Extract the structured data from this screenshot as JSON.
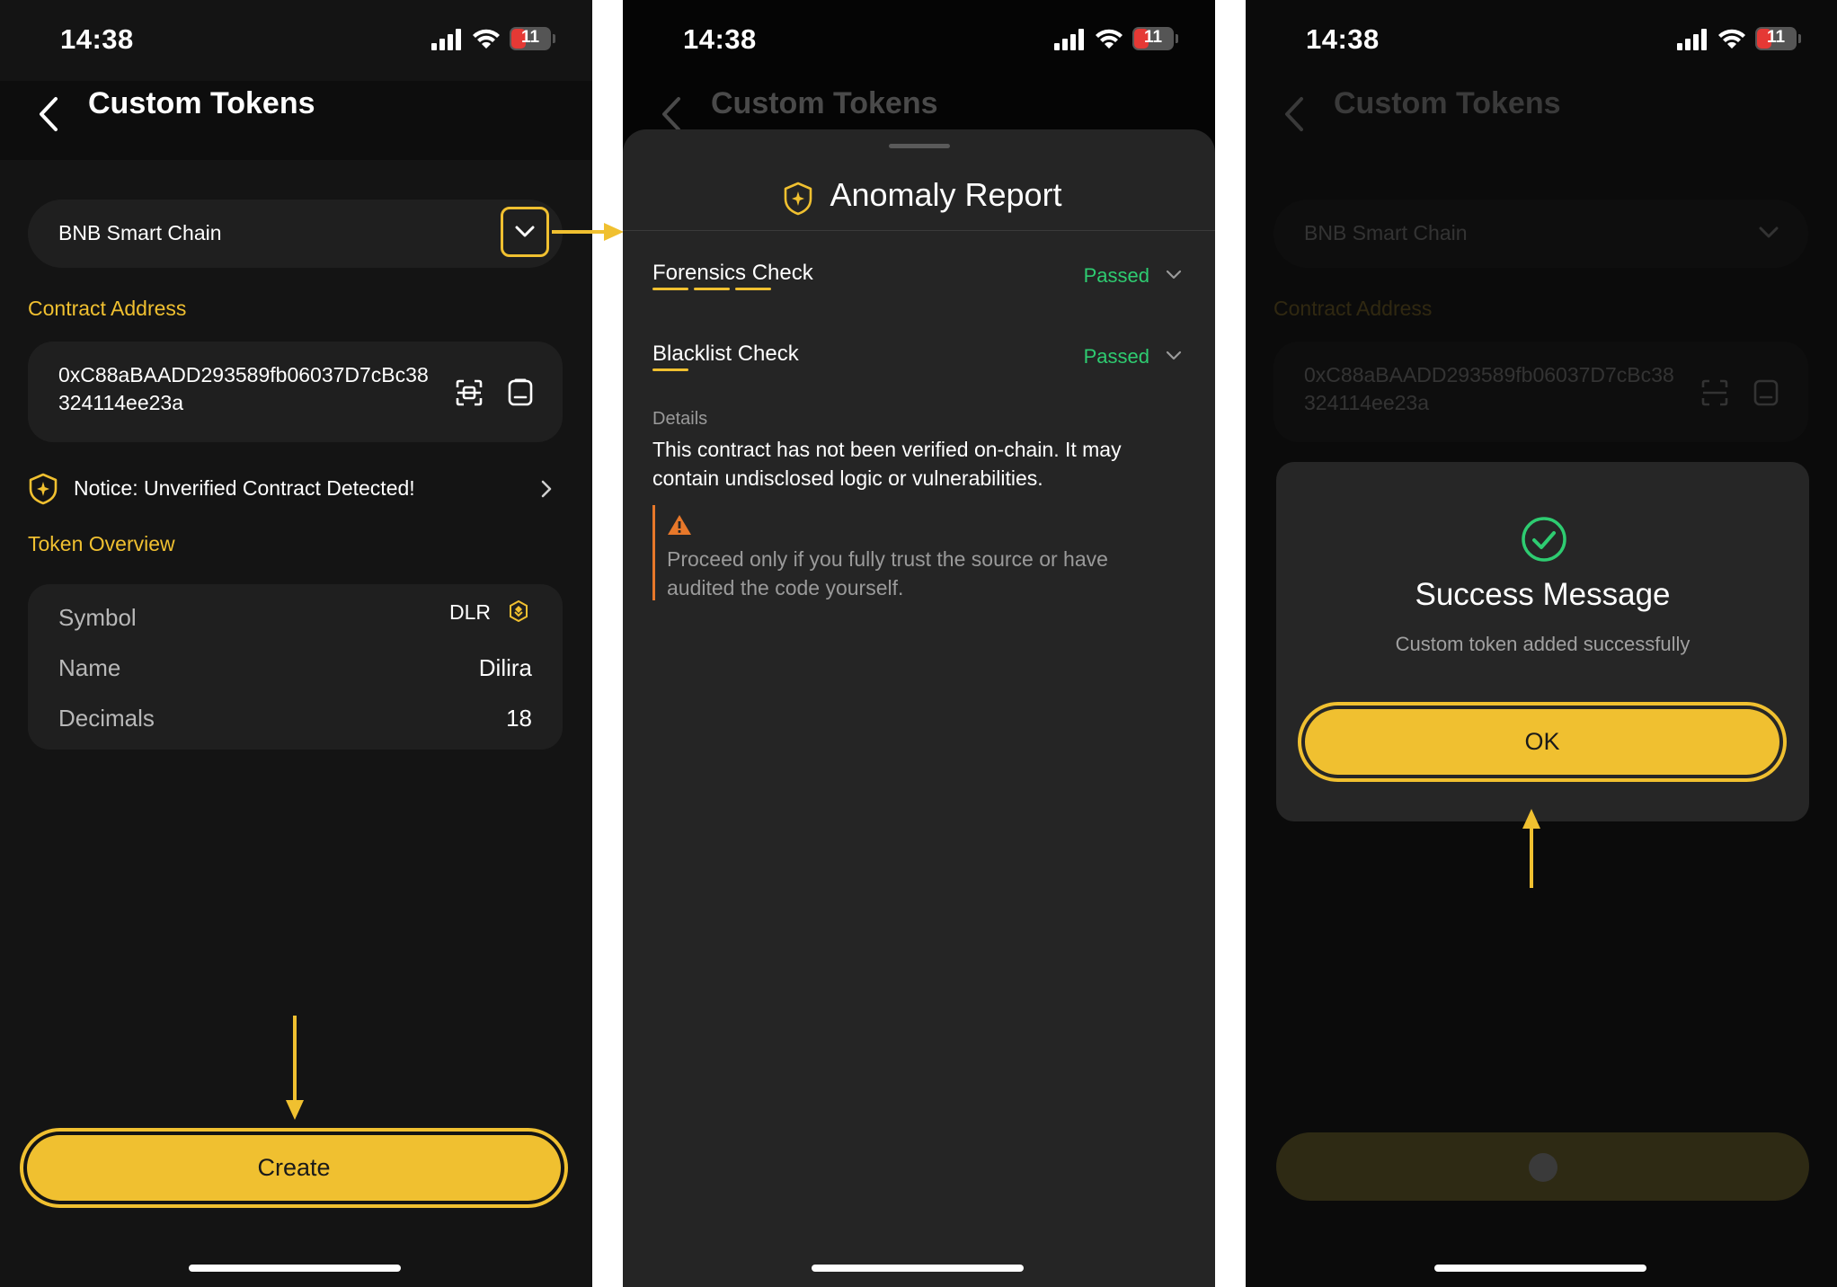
{
  "status_bar": {
    "time": "14:38",
    "battery": "11"
  },
  "header": {
    "title": "Custom Tokens"
  },
  "form": {
    "network": "BNB Smart Chain",
    "contract_label": "Contract Address",
    "contract_address": "0xC88aBAADD293589fb06037D7cBc38324114ee23a",
    "notice": "Notice: Unverified Contract Detected!",
    "overview_label": "Token Overview",
    "rows": [
      {
        "key": "Symbol",
        "value": "DLR"
      },
      {
        "key": "Name",
        "value": "Dilira"
      },
      {
        "key": "Decimals",
        "value": "18"
      }
    ],
    "create_label": "Create"
  },
  "report": {
    "title": "Anomaly Report",
    "checks": [
      {
        "name": "Forensics Check",
        "status": "Passed"
      },
      {
        "name": "Blacklist Check",
        "status": "Passed"
      }
    ],
    "details_label": "Details",
    "details_text": "This contract has not been verified on-chain. It may contain undisclosed logic or vulnerabilities.",
    "warning_text": "Proceed only if you fully trust the source or have audited the code yourself."
  },
  "success": {
    "title": "Success Message",
    "message": "Custom token added successfully",
    "ok_label": "OK"
  },
  "colors": {
    "accent": "#f0c030",
    "success": "#2ecc71",
    "warning": "#e8782a",
    "background": "#141414"
  }
}
